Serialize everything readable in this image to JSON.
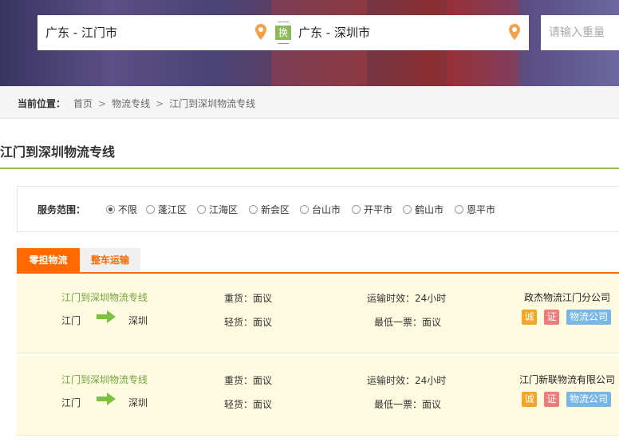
{
  "search": {
    "from_value": "广东 - 江门市",
    "to_value": "广东 - 深圳市",
    "swap_label": "换",
    "weight_placeholder": "请输入重量"
  },
  "breadcrumb": {
    "label": "当前位置：",
    "items": [
      "首页",
      "物流专线",
      "江门到深圳物流专线"
    ],
    "separator": ">"
  },
  "page_title": "江门到深圳物流专线",
  "filter": {
    "label": "服务范围：",
    "options": [
      "不限",
      "蓬江区",
      "江海区",
      "新会区",
      "台山市",
      "开平市",
      "鹤山市",
      "恩平市"
    ],
    "selected_index": 0
  },
  "tabs": [
    "零担物流",
    "整车运输"
  ],
  "listings": [
    {
      "line_name": "江门到深圳物流专线",
      "from": "江门",
      "to": "深圳",
      "heavy": "重货：面议",
      "light": "轻货：面议",
      "time": "运输时效：24小时",
      "min_ticket": "最低一票：面议",
      "company": "政杰物流江门分公司",
      "badges": [
        "诚",
        "证",
        "物流公司"
      ]
    },
    {
      "line_name": "江门到深圳物流专线",
      "from": "江门",
      "to": "深圳",
      "heavy": "重货：面议",
      "light": "轻货：面议",
      "time": "运输时效：24小时",
      "min_ticket": "最低一票：面议",
      "company": "江门新联物流有限公司",
      "badges": [
        "诚",
        "证",
        "物流公司"
      ]
    }
  ],
  "colors": {
    "accent_orange": "#ff6a00",
    "accent_green": "#8dc153",
    "row_bg": "#fffbe1"
  }
}
